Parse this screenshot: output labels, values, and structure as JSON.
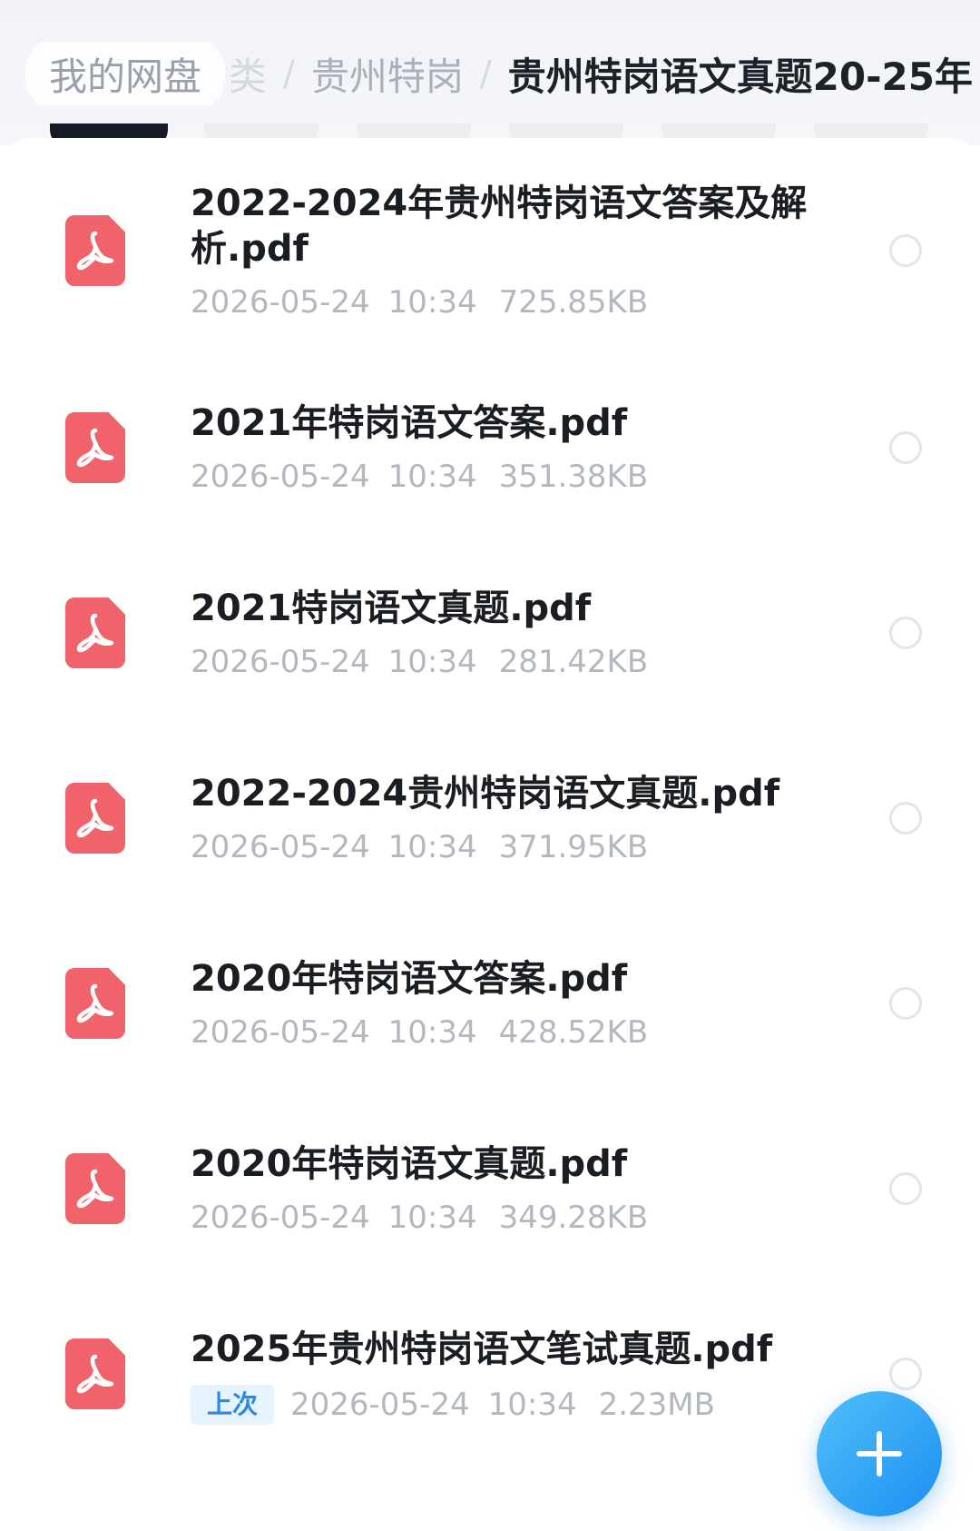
{
  "breadcrumb": {
    "root": "我的网盘",
    "partial": "类",
    "separator": "/",
    "parent": "贵州特岗",
    "current": "贵州特岗语文真题20-25年"
  },
  "files": [
    {
      "name": "2022-2024年贵州特岗语文答案及解析.pdf",
      "date": "2026-05-24",
      "time": "10:34",
      "size": "725.85KB",
      "icon": "pdf-icon"
    },
    {
      "name": "2021年特岗语文答案.pdf",
      "date": "2026-05-24",
      "time": "10:34",
      "size": "351.38KB",
      "icon": "pdf-icon"
    },
    {
      "name": "2021特岗语文真题.pdf",
      "date": "2026-05-24",
      "time": "10:34",
      "size": "281.42KB",
      "icon": "pdf-icon"
    },
    {
      "name": "2022-2024贵州特岗语文真题.pdf",
      "date": "2026-05-24",
      "time": "10:34",
      "size": "371.95KB",
      "icon": "pdf-icon"
    },
    {
      "name": "2020年特岗语文答案.pdf",
      "date": "2026-05-24",
      "time": "10:34",
      "size": "428.52KB",
      "icon": "pdf-icon"
    },
    {
      "name": "2020年特岗语文真题.pdf",
      "date": "2026-05-24",
      "time": "10:34",
      "size": "349.28KB",
      "icon": "pdf-icon"
    },
    {
      "name": "2025年贵州特岗语文笔试真题.pdf",
      "badge": "上次",
      "date": "2026-05-24",
      "time": "10:34",
      "size": "2.23MB",
      "icon": "pdf-icon"
    }
  ],
  "fab": {
    "icon": "plus-icon"
  },
  "colors": {
    "pdf_icon": "#f0636a",
    "accent": "#1e8ef2",
    "badge_bg": "#e6f2fc",
    "badge_text": "#2b8ae0",
    "active_chip": "#151a26"
  }
}
